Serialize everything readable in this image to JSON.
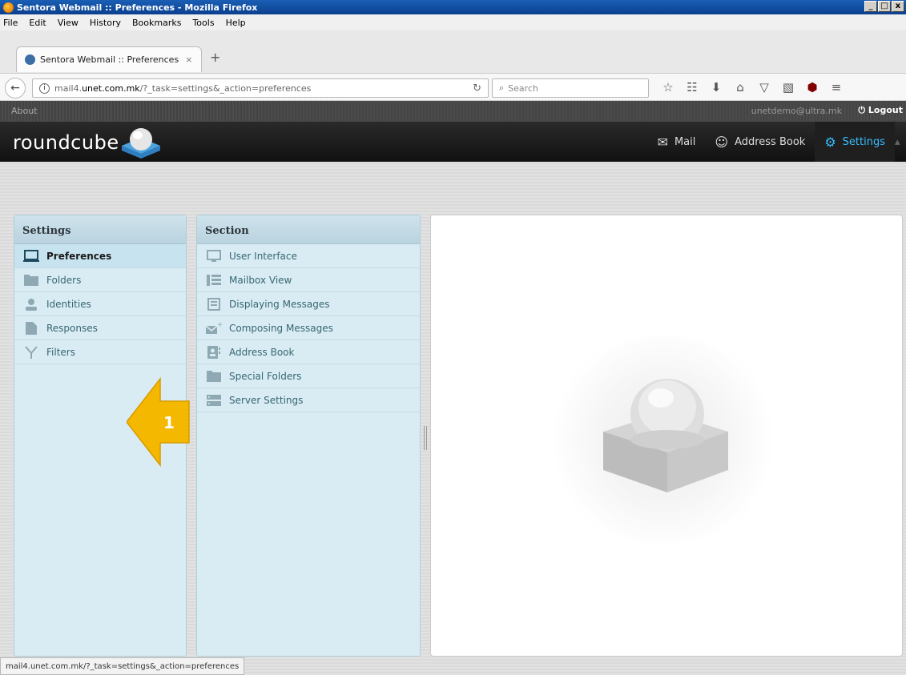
{
  "window": {
    "title": "Sentora Webmail :: Preferences - Mozilla Firefox",
    "buttons": [
      "_",
      "□",
      "x"
    ]
  },
  "menubar": [
    "File",
    "Edit",
    "View",
    "History",
    "Bookmarks",
    "Tools",
    "Help"
  ],
  "tab": {
    "title": "Sentora Webmail :: Preferences",
    "close": "×",
    "new_tab": "+"
  },
  "navbar": {
    "url_prefix": "mail4.",
    "url_host": "unet.com.mk",
    "url_path": "/?_task=settings&_action=preferences",
    "search_placeholder": "Search"
  },
  "topline": {
    "about": "About",
    "username": "unetdemo@ultra.mk",
    "logout": "Logout"
  },
  "header": {
    "logo": "roundcube",
    "tasks": [
      {
        "label": "Mail",
        "icon": "mail-icon"
      },
      {
        "label": "Address Book",
        "icon": "person-icon"
      },
      {
        "label": "Settings",
        "icon": "gear-icon",
        "selected": true
      }
    ]
  },
  "settings_panel": {
    "title": "Settings",
    "items": [
      {
        "label": "Preferences",
        "icon": "monitor-icon",
        "selected": true
      },
      {
        "label": "Folders",
        "icon": "folder-icon"
      },
      {
        "label": "Identities",
        "icon": "person-icon"
      },
      {
        "label": "Responses",
        "icon": "document-icon"
      },
      {
        "label": "Filters",
        "icon": "filter-icon"
      }
    ]
  },
  "section_panel": {
    "title": "Section",
    "items": [
      {
        "label": "User Interface",
        "icon": "monitor-icon"
      },
      {
        "label": "Mailbox View",
        "icon": "list-icon"
      },
      {
        "label": "Displaying Messages",
        "icon": "message-icon"
      },
      {
        "label": "Composing Messages",
        "icon": "compose-icon"
      },
      {
        "label": "Address Book",
        "icon": "contact-card-icon"
      },
      {
        "label": "Special Folders",
        "icon": "folder-icon"
      },
      {
        "label": "Server Settings",
        "icon": "server-icon"
      }
    ]
  },
  "annotation": {
    "number": "1",
    "color": "#f5b800"
  },
  "statusbar": "mail4.unet.com.mk/?_task=settings&_action=preferences",
  "colors": {
    "accent": "#37beff",
    "panel": "#d9ecf4",
    "header": "#1a1a1a"
  }
}
